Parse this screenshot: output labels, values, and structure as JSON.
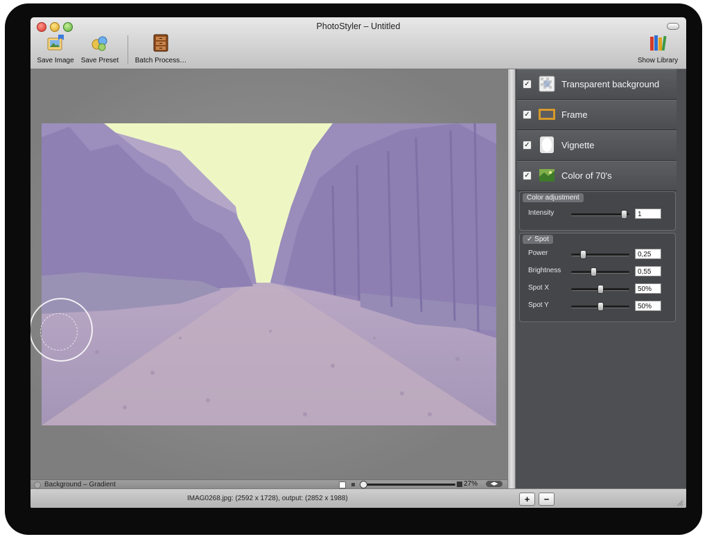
{
  "window": {
    "title": "PhotoStyler – Untitled"
  },
  "toolbar": {
    "save_image": "Save Image",
    "save_preset": "Save Preset",
    "batch_process": "Batch Process…",
    "show_library": "Show Library"
  },
  "canvas": {
    "background_label": "Background – Gradient",
    "zoom_percent": "27%",
    "zoom_level": 0.27
  },
  "effects": [
    {
      "label": "Transparent background",
      "checked": true
    },
    {
      "label": "Frame",
      "checked": true
    },
    {
      "label": "Vignette",
      "checked": true
    },
    {
      "label": "Color of 70's",
      "checked": true
    }
  ],
  "color_adjustment": {
    "group_label": "Color adjustment",
    "params": [
      {
        "label": "Intensity",
        "value": "1",
        "level": 0.92
      }
    ]
  },
  "spot": {
    "group_label": "Spot",
    "checkmark": "✓",
    "params": [
      {
        "label": "Power",
        "value": "0,25",
        "level": 0.2
      },
      {
        "label": "Brightness",
        "value": "0,55",
        "level": 0.38
      },
      {
        "label": "Spot X",
        "value": "50%",
        "level": 0.5
      },
      {
        "label": "Spot Y",
        "value": "50%",
        "level": 0.5
      }
    ]
  },
  "status": {
    "file_info": "IMAG0268.jpg: (2592 x 1728), output: (2852 x 1988)",
    "add_label": "+",
    "remove_label": "−"
  },
  "colors": {
    "panel_bg": "#4d4f52",
    "toolbar_top": "#e8e8e8",
    "photo_tint": "#b3a6c7",
    "sky": "#eef7c4"
  }
}
